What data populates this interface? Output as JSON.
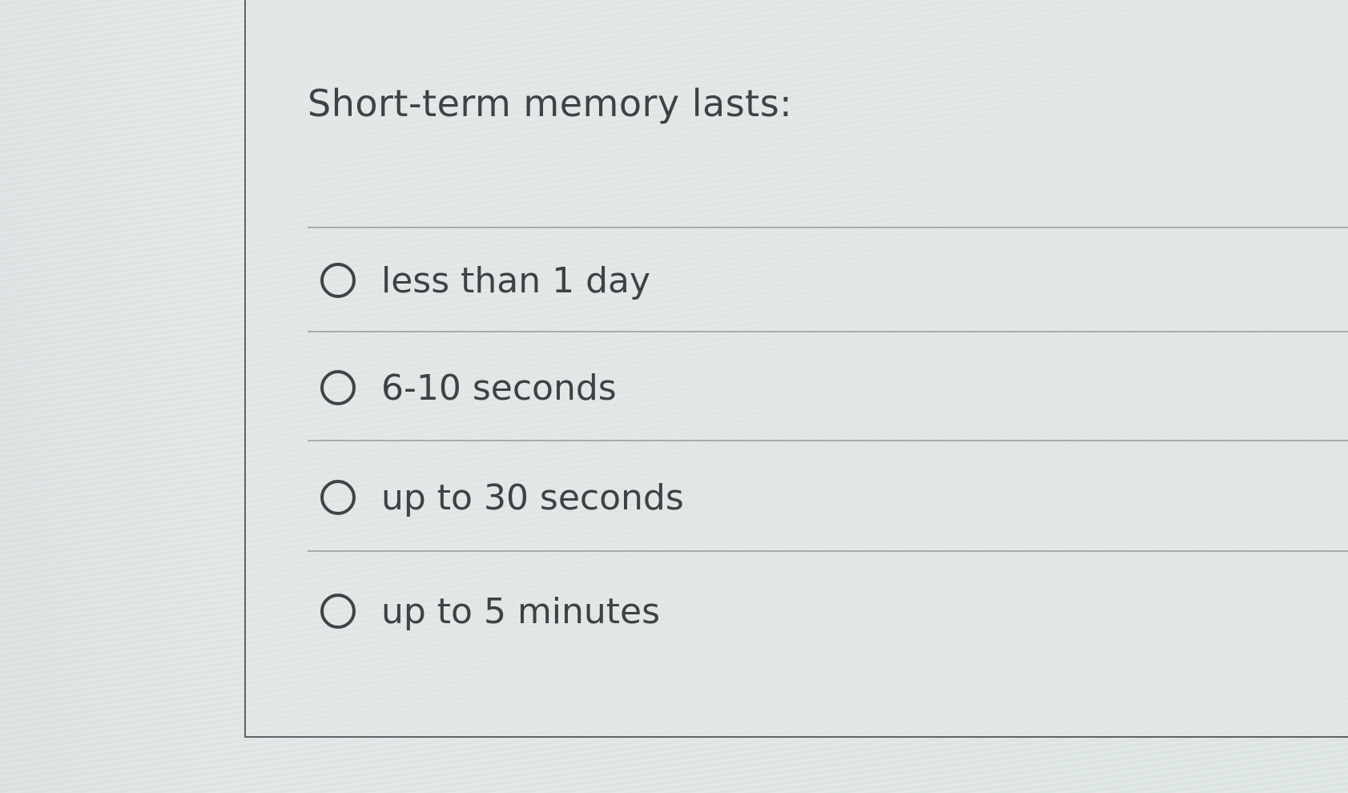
{
  "question": {
    "text": "Short-term memory lasts:"
  },
  "options": [
    {
      "label": "less than 1 day",
      "selected": false
    },
    {
      "label": "6-10 seconds",
      "selected": false
    },
    {
      "label": "up to 30 seconds",
      "selected": false
    },
    {
      "label": "up to 5 minutes",
      "selected": false
    }
  ],
  "colors": {
    "background": "#e3e7e7",
    "text": "#3d4244",
    "border": "#5f6466",
    "divider": "#a6adae"
  }
}
